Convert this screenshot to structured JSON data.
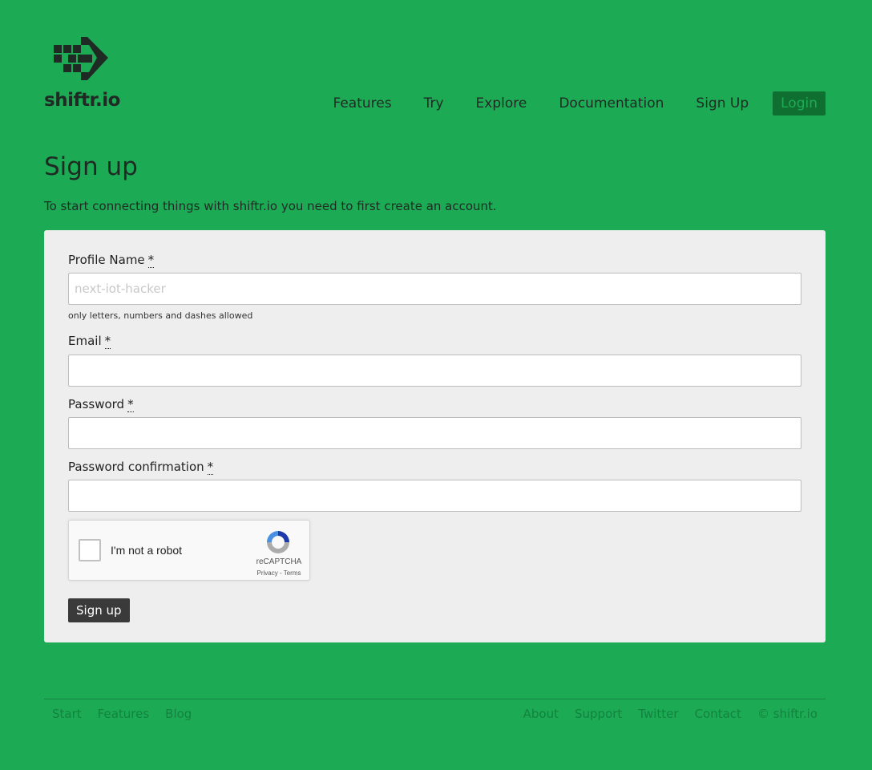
{
  "brand": {
    "name": "shiftr.io",
    "logo_icon": "pixel-arrow-icon"
  },
  "nav": {
    "items": [
      {
        "label": "Features"
      },
      {
        "label": "Try"
      },
      {
        "label": "Explore"
      },
      {
        "label": "Documentation"
      },
      {
        "label": "Sign Up"
      }
    ],
    "login_label": "Login"
  },
  "page": {
    "title": "Sign up",
    "intro": "To start connecting things with shiftr.io you need to first create an account."
  },
  "form": {
    "profile_name": {
      "label": "Profile Name",
      "required_mark": "*",
      "placeholder": "next-iot-hacker",
      "value": "",
      "hint": "only letters, numbers and dashes allowed"
    },
    "email": {
      "label": "Email",
      "required_mark": "*",
      "value": ""
    },
    "password": {
      "label": "Password",
      "required_mark": "*",
      "value": ""
    },
    "password_confirmation": {
      "label": "Password confirmation",
      "required_mark": "*",
      "value": ""
    },
    "captcha": {
      "label": "I'm not a robot",
      "brand": "reCAPTCHA",
      "links": "Privacy - Terms",
      "checked": false
    },
    "submit_label": "Sign up"
  },
  "footer": {
    "left": [
      {
        "label": "Start"
      },
      {
        "label": "Features"
      },
      {
        "label": "Blog"
      }
    ],
    "right": [
      {
        "label": "About"
      },
      {
        "label": "Support"
      },
      {
        "label": "Twitter"
      },
      {
        "label": "Contact"
      },
      {
        "label": "© shiftr.io"
      }
    ]
  },
  "colors": {
    "background": "#1cab54",
    "login_bg": "#0f6f31",
    "card_bg": "#eeeeee",
    "button_bg": "#3a3a3a"
  }
}
